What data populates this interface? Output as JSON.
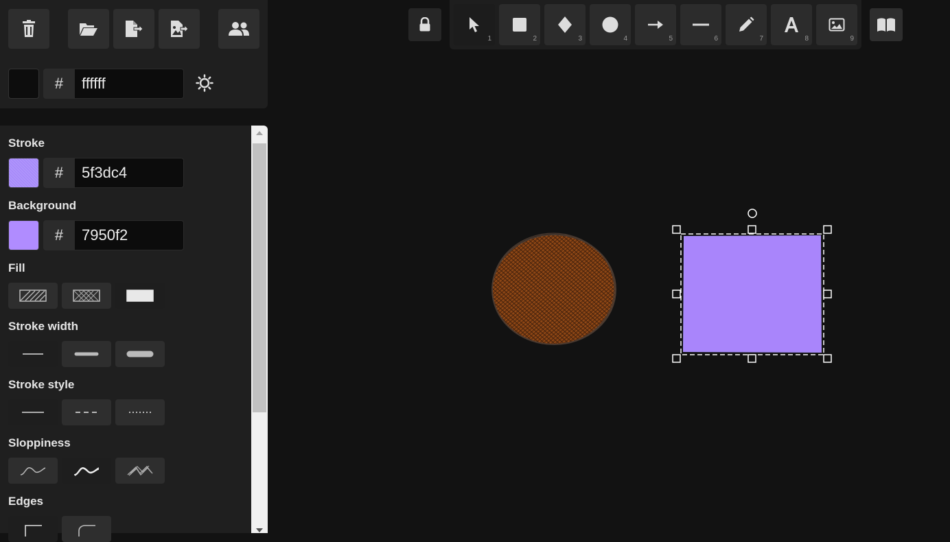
{
  "top_panel": {
    "canvas_background_hex": "ffffff",
    "canvas_swatch_color": "#0d0d0d",
    "buttons": [
      {
        "name": "clear-canvas-button",
        "icon": "trash-icon"
      },
      {
        "name": "load-button",
        "icon": "folder-open-icon"
      },
      {
        "name": "export-button",
        "icon": "file-export-icon"
      },
      {
        "name": "export-image-button",
        "icon": "image-export-icon"
      },
      {
        "name": "collaboration-button",
        "icon": "users-icon"
      }
    ]
  },
  "properties": {
    "stroke": {
      "label": "Stroke",
      "hash": "#",
      "hex": "5f3dc4",
      "swatch": "#a78bfa"
    },
    "background": {
      "label": "Background",
      "hash": "#",
      "hex": "7950f2",
      "swatch": "#b08cff"
    },
    "fill": {
      "label": "Fill",
      "options": [
        "hachure",
        "cross-hatch",
        "solid"
      ],
      "selected": "solid"
    },
    "stroke_width": {
      "label": "Stroke width",
      "options": [
        "thin",
        "bold",
        "extra-bold"
      ],
      "selected": "thin"
    },
    "stroke_style": {
      "label": "Stroke style",
      "options": [
        "solid",
        "dashed",
        "dotted"
      ],
      "selected": "solid"
    },
    "sloppiness": {
      "label": "Sloppiness",
      "options": [
        "architect",
        "artist",
        "cartoonist"
      ],
      "selected": "artist"
    },
    "edges": {
      "label": "Edges",
      "options": [
        "sharp",
        "round"
      ],
      "selected": "sharp"
    }
  },
  "toolbar": {
    "lock_icon": "lock-icon",
    "tools": [
      {
        "name": "selection",
        "icon": "cursor-icon",
        "key": "1",
        "selected": true
      },
      {
        "name": "rectangle",
        "icon": "square-icon",
        "key": "2"
      },
      {
        "name": "diamond",
        "icon": "diamond-icon",
        "key": "3"
      },
      {
        "name": "ellipse",
        "icon": "circle-icon",
        "key": "4"
      },
      {
        "name": "arrow",
        "icon": "arrow-icon",
        "key": "5"
      },
      {
        "name": "line",
        "icon": "line-icon",
        "key": "6"
      },
      {
        "name": "draw",
        "icon": "pencil-icon",
        "key": "7"
      },
      {
        "name": "text",
        "icon": "text-icon",
        "key": "8"
      },
      {
        "name": "image",
        "icon": "image-icon",
        "key": "9"
      }
    ],
    "library_icon": "book-icon"
  },
  "canvas": {
    "ellipse": {
      "stroke": "#5c3d2e",
      "fill": "#8b4513",
      "fill_style": "hachure"
    },
    "rectangle": {
      "stroke": "#a78bfa",
      "fill": "#a985fb",
      "selected": true
    }
  }
}
